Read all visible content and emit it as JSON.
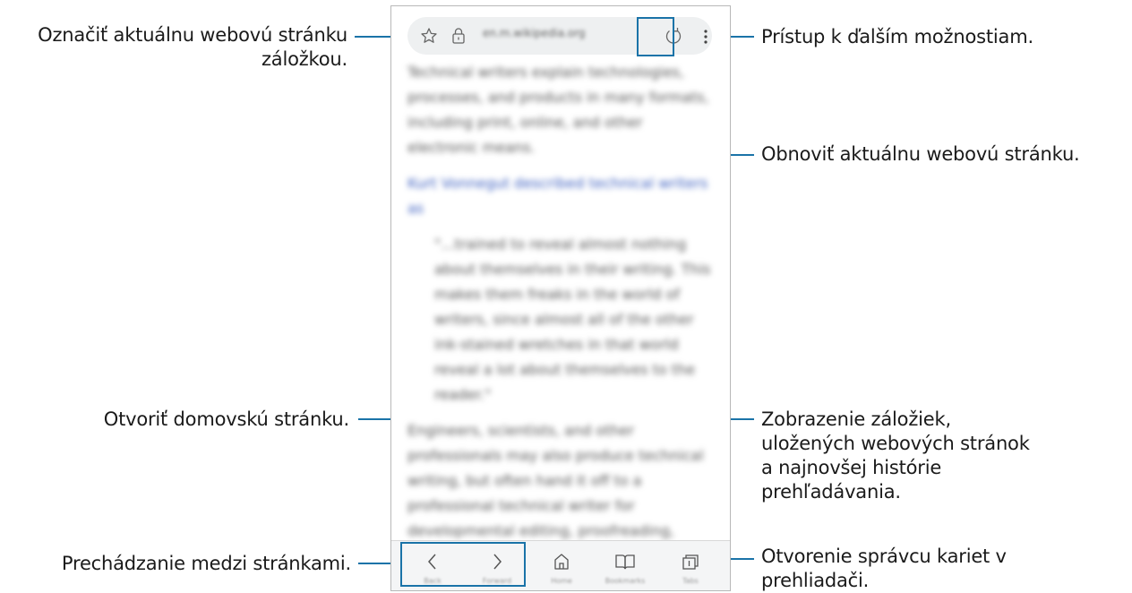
{
  "browser": {
    "url": "en.m.wikipedia.org",
    "article": {
      "paragraphs": [
        "Technical writers explain technologies, processes, and products in many formats, including print, online, and other electronic means.",
        "Kurt Vonnegut described technical writers as",
        "\"...trained to reveal almost nothing about themselves in their writing. This makes them freaks in the world of writers, since almost all of the other ink-stained wretches in that world reveal a lot about themselves to the reader.\"",
        "Engineers, scientists, and other professionals may also produce technical writing, but often hand it off to a professional technical writer for developmental editing, proofreading, editing, formatting, and delivery in their audiences."
      ]
    },
    "bottom_bar": {
      "back_label": "Back",
      "forward_label": "Forward",
      "home_label": "Home",
      "bookmarks_label": "Bookmarks",
      "tabs_label": "Tabs"
    }
  },
  "callouts": {
    "bookmark": "Označiť aktuálnu webovú stránku záložkou.",
    "more_options": "Prístup k ďalším možnostiam.",
    "refresh": "Obnoviť aktuálnu webovú stránku.",
    "home": "Otvoriť domovskú stránku.",
    "bookmarks_view": "Zobrazenie záložiek, uložených webových stránok a najnovšej histórie prehľadávania.",
    "navigate": "Prechádzanie medzi stránkami.",
    "tabs_manager": "Otvorenie správcu kariet v prehliadači."
  },
  "colors": {
    "callout_line": "#1a73a8",
    "link": "#3c5fc0"
  }
}
